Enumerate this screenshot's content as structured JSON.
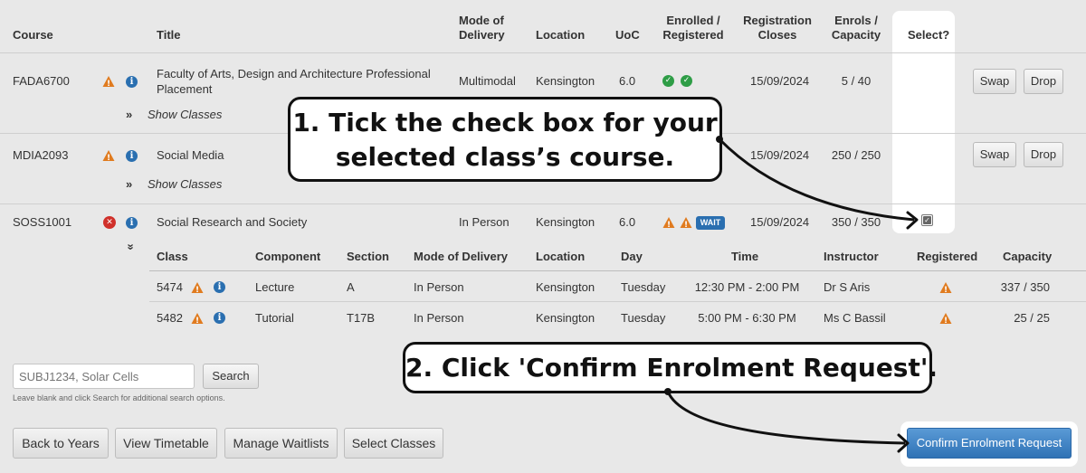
{
  "headers": {
    "course": "Course",
    "title": "Title",
    "mode": "Mode of\nDelivery",
    "location": "Location",
    "uoc": "UoC",
    "enrolled": "Enrolled /\nRegistered",
    "reg_closes": "Registration\nCloses",
    "enrols": "Enrols /\nCapacity",
    "select": "Select?"
  },
  "courses": [
    {
      "code": "FADA6700",
      "title": "Faculty of Arts, Design and Architecture Professional\nPlacement",
      "mode": "Multimodal",
      "location": "Kensington",
      "uoc": "6.0",
      "closes": "15/09/2024",
      "enrols": "5 / 40",
      "swap": "Swap",
      "drop": "Drop",
      "show_classes": "Show Classes"
    },
    {
      "code": "MDIA2093",
      "title": "Social Media",
      "closes": "15/09/2024",
      "enrols": "250 / 250",
      "swap": "Swap",
      "drop": "Drop",
      "show_classes": "Show Classes"
    },
    {
      "code": "SOSS1001",
      "title": "Social Research and Society",
      "mode": "In Person",
      "location": "Kensington",
      "uoc": "6.0",
      "badge": "WAIT",
      "closes": "15/09/2024",
      "enrols": "350 / 350",
      "selected": true
    }
  ],
  "class_headers": {
    "class": "Class",
    "component": "Component",
    "section": "Section",
    "mode": "Mode of Delivery",
    "location": "Location",
    "day": "Day",
    "time": "Time",
    "instructor": "Instructor",
    "registered": "Registered",
    "capacity": "Capacity"
  },
  "classes": [
    {
      "class": "5474",
      "component": "Lecture",
      "section": "A",
      "mode": "In Person",
      "location": "Kensington",
      "day": "Tuesday",
      "time": "12:30 PM - 2:00 PM",
      "instructor": "Dr S Aris",
      "capacity": "337 / 350"
    },
    {
      "class": "5482",
      "component": "Tutorial",
      "section": "T17B",
      "mode": "In Person",
      "location": "Kensington",
      "day": "Tuesday",
      "time": "5:00 PM - 6:30 PM",
      "instructor": "Ms C Bassil",
      "capacity": "25 / 25"
    }
  ],
  "search": {
    "placeholder": "SUBJ1234, Solar Cells",
    "button": "Search",
    "hint": "Leave blank and click Search for additional search options."
  },
  "bottom_buttons": {
    "back": "Back to Years",
    "timetable": "View Timetable",
    "waitlists": "Manage Waitlists",
    "select_classes": "Select Classes",
    "confirm": "Confirm Enrolment Request"
  },
  "callouts": {
    "step1": "1. Tick the check box for your\nselected class’s course.",
    "step2": "2. Click 'Confirm Enrolment Request'."
  },
  "colors": {
    "warning": "#e07b1f",
    "info": "#2a6fb0",
    "error": "#d0302a",
    "ok": "#2e9d46",
    "confirm": "#3a7fc1"
  }
}
